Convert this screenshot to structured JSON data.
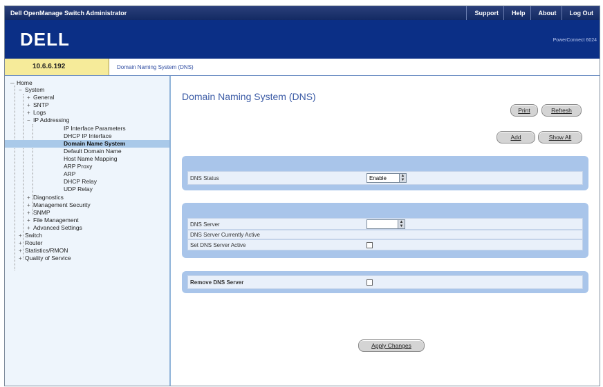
{
  "header": {
    "app_title": "Dell OpenManage Switch Administrator",
    "links": [
      "Support",
      "Help",
      "About",
      "Log Out"
    ],
    "logo": "DELL",
    "product": "PowerConnect 6024"
  },
  "crumbbar": {
    "ip": "10.6.6.192",
    "breadcrumb": "Domain Naming System (DNS)"
  },
  "sidebar": {
    "items": [
      {
        "label": "Home",
        "exp": "─"
      },
      {
        "label": "System",
        "exp": "−"
      },
      {
        "label": "General",
        "exp": "+"
      },
      {
        "label": "SNTP",
        "exp": "+"
      },
      {
        "label": "Logs",
        "exp": "+"
      },
      {
        "label": "IP Addressing",
        "exp": "−"
      },
      {
        "label": "IP Interface Parameters",
        "exp": ""
      },
      {
        "label": "DHCP IP Interface",
        "exp": ""
      },
      {
        "label": "Domain Name System",
        "exp": ""
      },
      {
        "label": "Default Domain Name",
        "exp": ""
      },
      {
        "label": "Host Name Mapping",
        "exp": ""
      },
      {
        "label": "ARP Proxy",
        "exp": ""
      },
      {
        "label": "ARP",
        "exp": ""
      },
      {
        "label": "DHCP Relay",
        "exp": ""
      },
      {
        "label": "UDP Relay",
        "exp": ""
      },
      {
        "label": "Diagnostics",
        "exp": "+"
      },
      {
        "label": "Management Security",
        "exp": "+"
      },
      {
        "label": "SNMP",
        "exp": "+"
      },
      {
        "label": "File Management",
        "exp": "+"
      },
      {
        "label": "Advanced Settings",
        "exp": "+"
      },
      {
        "label": "Switch",
        "exp": "+"
      },
      {
        "label": "Router",
        "exp": "+"
      },
      {
        "label": "Statistics/RMON",
        "exp": "+"
      },
      {
        "label": "Quality of Service",
        "exp": "+"
      }
    ]
  },
  "main": {
    "title": "Domain Naming System (DNS)",
    "buttons": {
      "print": "Print",
      "refresh": "Refresh",
      "add": "Add",
      "show_all": "Show All",
      "apply": "Apply Changes"
    },
    "dns_status_label": "DNS Status",
    "dns_status_value": "Enable",
    "dns_server_label": "DNS Server",
    "dns_server_value": "",
    "dns_server_active_label": "DNS Server Currently Active",
    "set_dns_active_label": "Set DNS Server Active",
    "set_dns_active_checked": false,
    "remove_dns_label": "Remove DNS Server",
    "remove_dns_checked": false
  }
}
